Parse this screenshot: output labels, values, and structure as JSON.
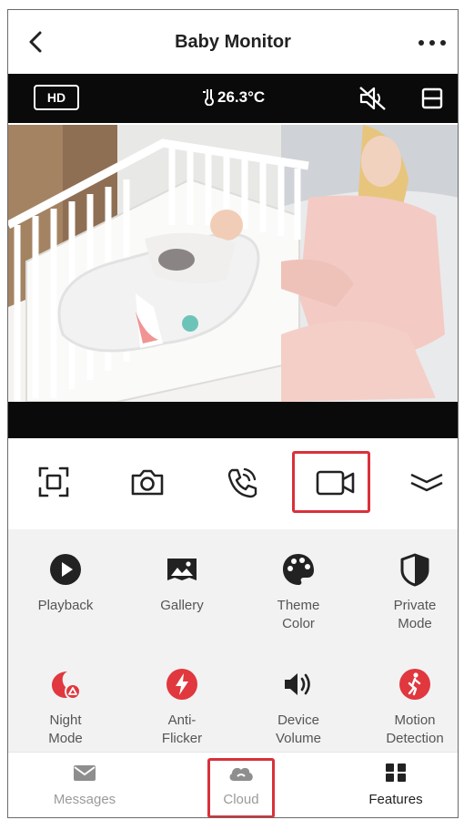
{
  "header": {
    "title": "Baby Monitor"
  },
  "status": {
    "quality": "HD",
    "temperature": "26.3°C"
  },
  "features": [
    {
      "label": "Playback",
      "icon": "play-circle-icon",
      "color": "#222222"
    },
    {
      "label": "Gallery",
      "icon": "gallery-icon",
      "color": "#222222"
    },
    {
      "label": "Theme\nColor",
      "icon": "palette-icon",
      "color": "#222222"
    },
    {
      "label": "Private\nMode",
      "icon": "private-mode-icon",
      "color": "#222222"
    },
    {
      "label": "Night\nMode",
      "icon": "night-mode-icon",
      "color": "#e0383e"
    },
    {
      "label": "Anti-\nFlicker",
      "icon": "lightning-icon",
      "color": "#e0383e"
    },
    {
      "label": "Device\nVolume",
      "icon": "speaker-icon",
      "color": "#222222"
    },
    {
      "label": "Motion\nDetection",
      "icon": "walking-person-icon",
      "color": "#e0383e"
    }
  ],
  "nav": [
    {
      "label": "Messages",
      "icon": "envelope-icon",
      "color": "#9a9a9a"
    },
    {
      "label": "Cloud",
      "icon": "cloud-icon",
      "color": "#9a9a9a"
    },
    {
      "label": "Features",
      "icon": "grid-icon",
      "color": "#222222"
    }
  ],
  "colors": {
    "accent": "#e0383e",
    "highlight_border": "#d9313a"
  }
}
